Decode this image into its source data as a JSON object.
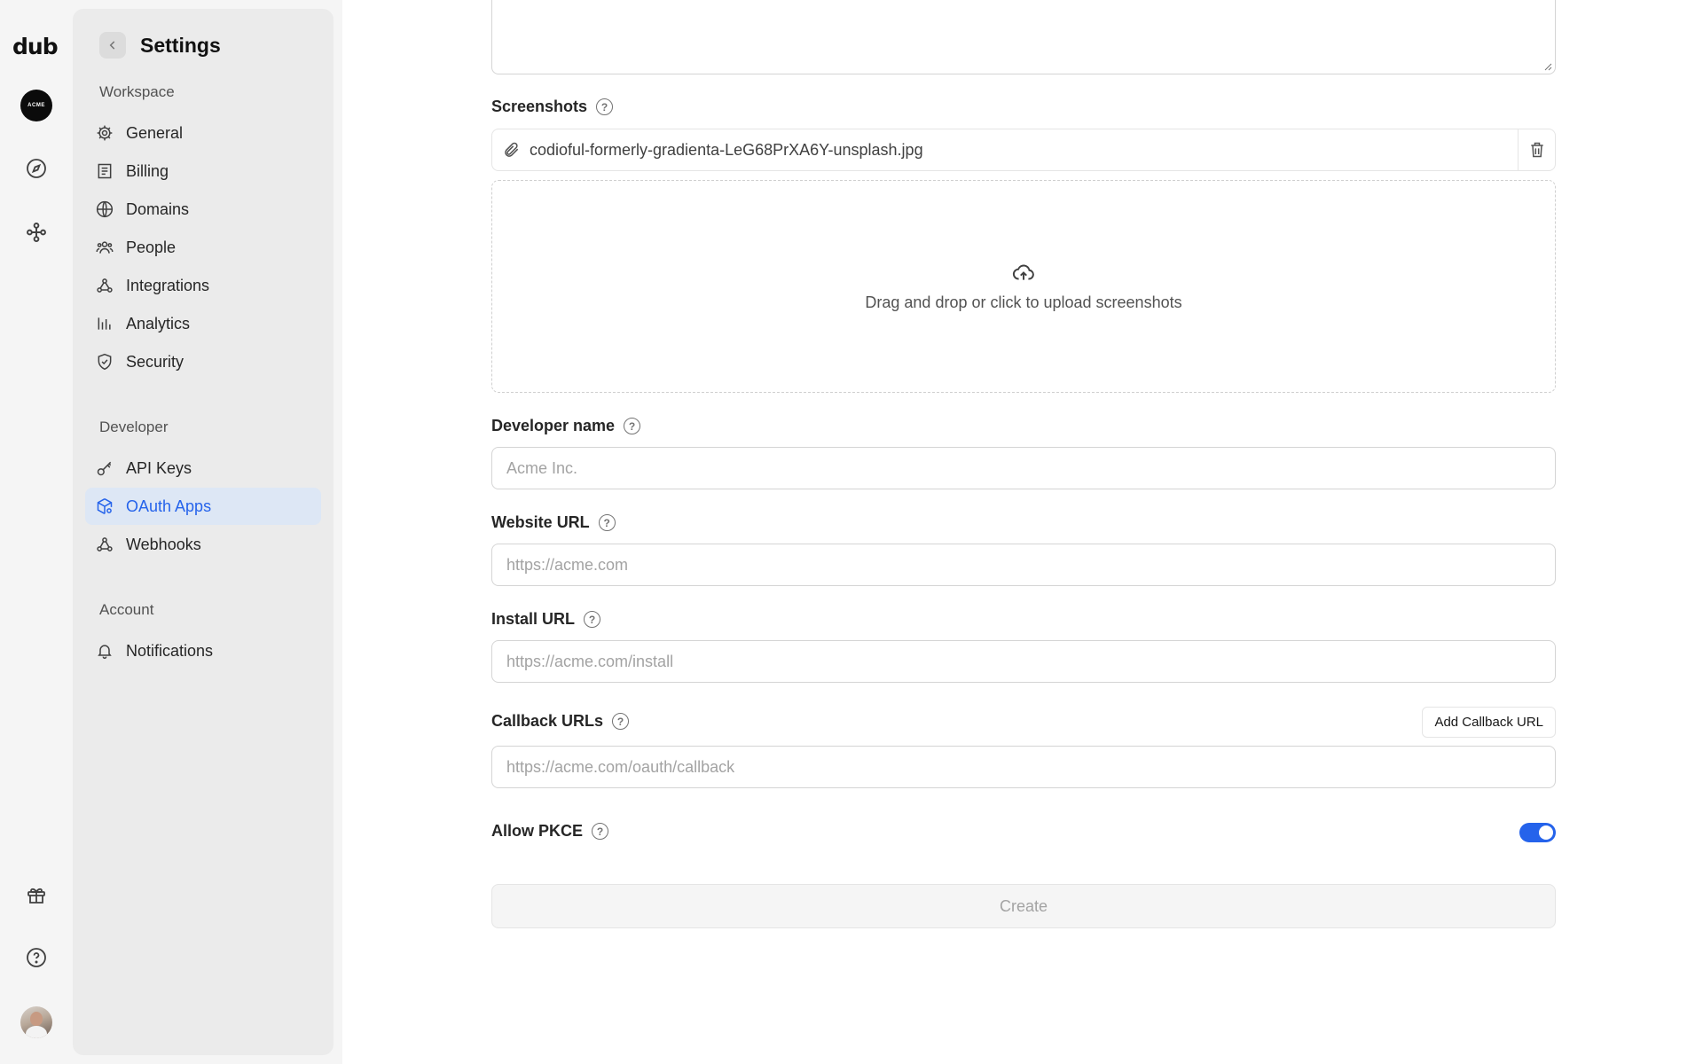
{
  "rail": {
    "logo": "dub",
    "workspace_avatar_text": "ACME",
    "icons": [
      "compass-icon",
      "integrations-icon",
      "gift-icon",
      "help-icon"
    ]
  },
  "sidebar": {
    "title": "Settings",
    "sections": [
      {
        "label": "Workspace",
        "items": [
          {
            "label": "General",
            "icon": "gear-icon"
          },
          {
            "label": "Billing",
            "icon": "receipt-icon"
          },
          {
            "label": "Domains",
            "icon": "globe-icon"
          },
          {
            "label": "People",
            "icon": "users-icon"
          },
          {
            "label": "Integrations",
            "icon": "integrations-icon"
          },
          {
            "label": "Analytics",
            "icon": "chart-icon"
          },
          {
            "label": "Security",
            "icon": "shield-icon"
          }
        ]
      },
      {
        "label": "Developer",
        "items": [
          {
            "label": "API Keys",
            "icon": "key-icon"
          },
          {
            "label": "OAuth Apps",
            "icon": "cube-settings-icon",
            "active": true
          },
          {
            "label": "Webhooks",
            "icon": "webhook-icon"
          }
        ]
      },
      {
        "label": "Account",
        "items": [
          {
            "label": "Notifications",
            "icon": "bell-icon"
          }
        ]
      }
    ]
  },
  "form": {
    "screenshots": {
      "label": "Screenshots",
      "file_name": "codioful-formerly-gradienta-LeG68PrXA6Y-unsplash.jpg",
      "dropzone_text": "Drag and drop or click to upload screenshots"
    },
    "developer_name": {
      "label": "Developer name",
      "placeholder": "Acme Inc."
    },
    "website_url": {
      "label": "Website URL",
      "placeholder": "https://acme.com"
    },
    "install_url": {
      "label": "Install URL",
      "placeholder": "https://acme.com/install"
    },
    "callback_urls": {
      "label": "Callback URLs",
      "add_button": "Add Callback URL",
      "placeholder": "https://acme.com/oauth/callback"
    },
    "allow_pkce": {
      "label": "Allow PKCE",
      "enabled": true
    },
    "submit_label": "Create"
  },
  "colors": {
    "accent": "#2563eb",
    "active_bg": "#dde7f5",
    "sidebar_bg": "#ebebeb"
  }
}
